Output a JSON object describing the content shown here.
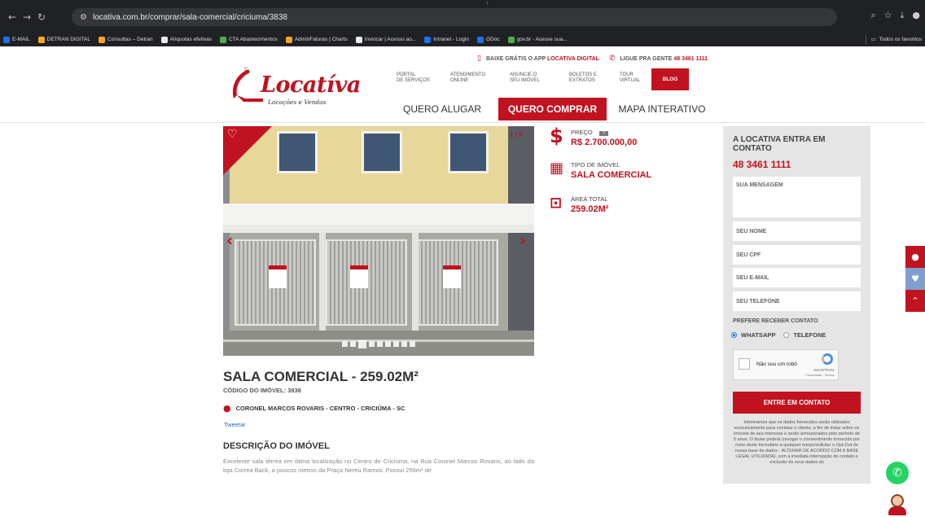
{
  "browser": {
    "url": "locativa.com.br/comprar/sala-comercial/criciuma/3838",
    "bookmarks": [
      {
        "label": "E-MAIL",
        "color": "#1a73e8"
      },
      {
        "label": "DETRAN DIGITAL",
        "color": "#f6a623"
      },
      {
        "label": "Consultas – Detran",
        "color": "#f6a623"
      },
      {
        "label": "Alíquotas efetivas",
        "color": "#e8eaed"
      },
      {
        "label": "CTA Abastecimentos",
        "color": "#4caf50"
      },
      {
        "label": "AdminFaturas | Charts",
        "color": "#f6a623"
      },
      {
        "label": "Inviocar | Acesso ao...",
        "color": "#e8eaed"
      },
      {
        "label": "Intranet - Login",
        "color": "#1a73e8"
      },
      {
        "label": "GDoc",
        "color": "#1a73e8"
      },
      {
        "label": "gov.br - Acesse sua...",
        "color": "#4caf50"
      }
    ],
    "all_favorites": "Todos os favoritos"
  },
  "topinfo": {
    "app_prefix": "BAIXE GRÁTIS O APP",
    "app_name": "LOCATIVA DIGITAL",
    "call_prefix": "LIGUE PRA GENTE",
    "phone": "48 3461 1111"
  },
  "logo": {
    "wordmark": "Locatíva",
    "tagline": "Locações e Vendas"
  },
  "menu_small": [
    {
      "l1": "PORTAL",
      "l2": "DE SERVIÇOS"
    },
    {
      "l1": "ATENDIMENTO",
      "l2": "ONLINE"
    },
    {
      "l1": "ANUNCIE O",
      "l2": "SEU IMÓVEL"
    },
    {
      "l1": "BOLETOS E",
      "l2": "EXTRATOS"
    },
    {
      "l1": "TOUR",
      "l2": "VIRTUAL"
    }
  ],
  "blog": "BLOG",
  "main_nav": [
    "QUERO ALUGAR",
    "QUERO COMPRAR",
    "MAPA INTERATIVO"
  ],
  "gallery": {
    "counter": "1 / 9",
    "photo_sign": "LOCATIVA",
    "dots_count": 9,
    "active_dot": 2
  },
  "facts": {
    "price_label": "PREÇO",
    "price_help": "?",
    "price_value": "R$ 2.700.000,00",
    "type_label": "TIPO DE IMÓVEL",
    "type_value": "SALA COMERCIAL",
    "area_label": "ÁREA TOTAL",
    "area_value": "259.02M²"
  },
  "listing": {
    "title": "SALA COMERCIAL - 259.02M²",
    "code": "CÓDIGO DO IMÓVEL: 3838",
    "address": "CORONEL MARCOS ROVARIS - CENTRO - CRICIÚMA - SC",
    "tweet": "Tweetar",
    "desc_heading": "DESCRIÇÃO DO IMÓVEL",
    "description": "Excelente sala térrea em ótima localização no Centro de Criciúma, na Rua Coronel Marcos Rovaris, ao lado da loja Correa Back, a poucos metros da Praça Nereu Ramos. Possui 259m² de"
  },
  "form": {
    "heading": "A LOCATIVA ENTRA EM CONTATO",
    "phone": "48 3461 1111",
    "message_ph": "SUA MENSAGEM",
    "name_ph": "SEU NOME",
    "cpf_ph": "SEU CPF",
    "email_ph": "SEU E-MAIL",
    "phone_ph": "SEU TELEFONE",
    "prefer_label": "PREFERE RECEBER CONTATO",
    "option_whatsapp": "WHATSAPP",
    "option_phone": "TELEFONE",
    "selected": "WHATSAPP",
    "captcha_label": "Não sou um robô",
    "captcha_brand": "reCAPTCHA",
    "captcha_terms": "Privacidade - Termos",
    "submit": "ENTRE EM CONTATO",
    "legal": "Informamos que os dados fornecidos serão utilizados exclusivamente para contatar o cliente, a fim de tratar sobre os imóveis de seu interesse e serão armazenados pelo período de 5 anos. O titular poderá (revogar o consentimento fornecido por meio deste formulário a qualquer tempo/solicitar o Opt-Out de nossa base de dados - ALTERAR DE ACORDO COM A BASE LEGAL UTILIZADA), com a imediata interrupção do contato e exclusão de seus dados do"
  },
  "side_tabs_badge": "0",
  "colors": {
    "brand_red": "#c1121f",
    "whatsapp_green": "#25d366",
    "link_blue": "#1b6fb8"
  }
}
